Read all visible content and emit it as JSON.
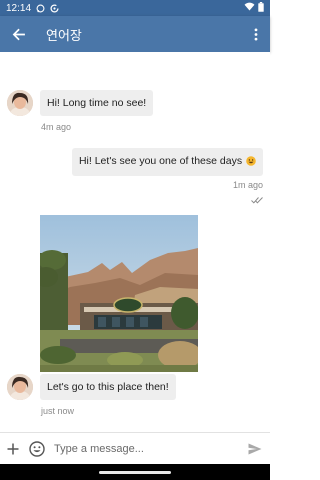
{
  "status_bar": {
    "time": "12:14",
    "icons": [
      "chat-bubble-icon",
      "data-saver-icon",
      "wifi-icon",
      "battery-icon"
    ]
  },
  "app_bar": {
    "title": "연어장",
    "back_icon": "arrow-back-icon",
    "more_icon": "more-vert-icon",
    "color": "#4a76a8"
  },
  "messages": [
    {
      "direction": "incoming",
      "text": "Hi! Long time no see!",
      "time": "4m ago"
    },
    {
      "direction": "outgoing",
      "text": "Hi! Let's see you one of these days",
      "emoji": "grinning-face-emoji",
      "time": "1m ago",
      "status_icon": "double-check-icon"
    },
    {
      "direction": "incoming",
      "type": "image",
      "image": "photo-restaurant-mountains"
    },
    {
      "direction": "incoming",
      "text": "Let's go to this place then!",
      "time": "just now"
    }
  ],
  "input_bar": {
    "placeholder": "Type a message...",
    "add_icon": "plus-icon",
    "emoji_icon": "emoji-icon",
    "send_icon": "send-icon"
  }
}
